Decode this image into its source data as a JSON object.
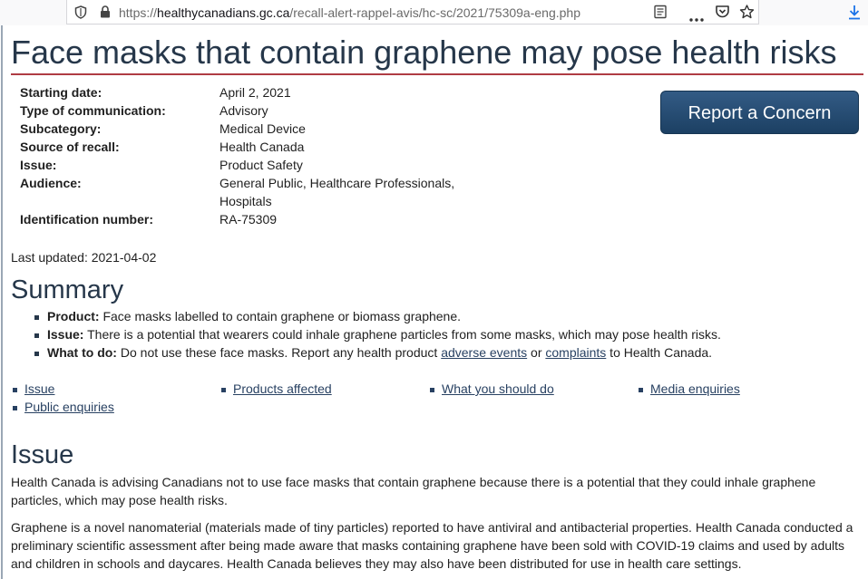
{
  "browser": {
    "url_prefix": "https://",
    "url_host": "healthycanadians.gc.ca",
    "url_path": "/recall-alert-rappel-avis/hc-sc/2021/75309a-eng.php",
    "icons": [
      "shield-icon",
      "lock-icon",
      "reader-view-icon",
      "more-icon",
      "pocket-icon",
      "bookmark-star-icon",
      "download-icon"
    ]
  },
  "page": {
    "title": "Face masks that contain graphene may pose health risks",
    "info": [
      {
        "label": "Starting date:",
        "value": "April 2, 2021"
      },
      {
        "label": "Type of communication:",
        "value": "Advisory"
      },
      {
        "label": "Subcategory:",
        "value": "Medical Device"
      },
      {
        "label": "Source of recall:",
        "value": "Health Canada"
      },
      {
        "label": "Issue:",
        "value": "Product Safety"
      },
      {
        "label": "Audience:",
        "value": "General Public, Healthcare Professionals,",
        "value2": "Hospitals"
      },
      {
        "label": "Identification number:",
        "value": "RA-75309"
      }
    ],
    "report_button": "Report a Concern",
    "last_updated": "Last updated: 2021-04-02",
    "summary_heading": "Summary",
    "summary": {
      "product_label": "Product:",
      "product_text": " Face masks labelled to contain graphene or biomass graphene.",
      "issue_label": "Issue:",
      "issue_text": " There is a potential that wearers could inhale graphene particles from some masks, which may pose health risks.",
      "todo_label": "What to do:",
      "todo_text_1": " Do not use these face masks. Report any health product ",
      "todo_link_1": "adverse events",
      "todo_text_2": " or ",
      "todo_link_2": "complaints",
      "todo_text_3": " to Health Canada."
    },
    "toc": [
      "Issue",
      "Products affected",
      "What you should do",
      "Media enquiries",
      "Public enquiries"
    ],
    "issue_heading": "Issue",
    "issue_paragraphs": [
      "Health Canada is advising Canadians not to use face masks that contain graphene because there is a potential that they could inhale graphene particles, which may pose health risks.",
      "Graphene is a novel nanomaterial (materials made of tiny particles) reported to have antiviral and antibacterial properties. Health Canada conducted a preliminary scientific assessment after being made aware that masks containing graphene have been sold with COVID-19 claims and used by adults and children in schools and daycares. Health Canada believes they may also have been distributed for use in health care settings."
    ]
  }
}
